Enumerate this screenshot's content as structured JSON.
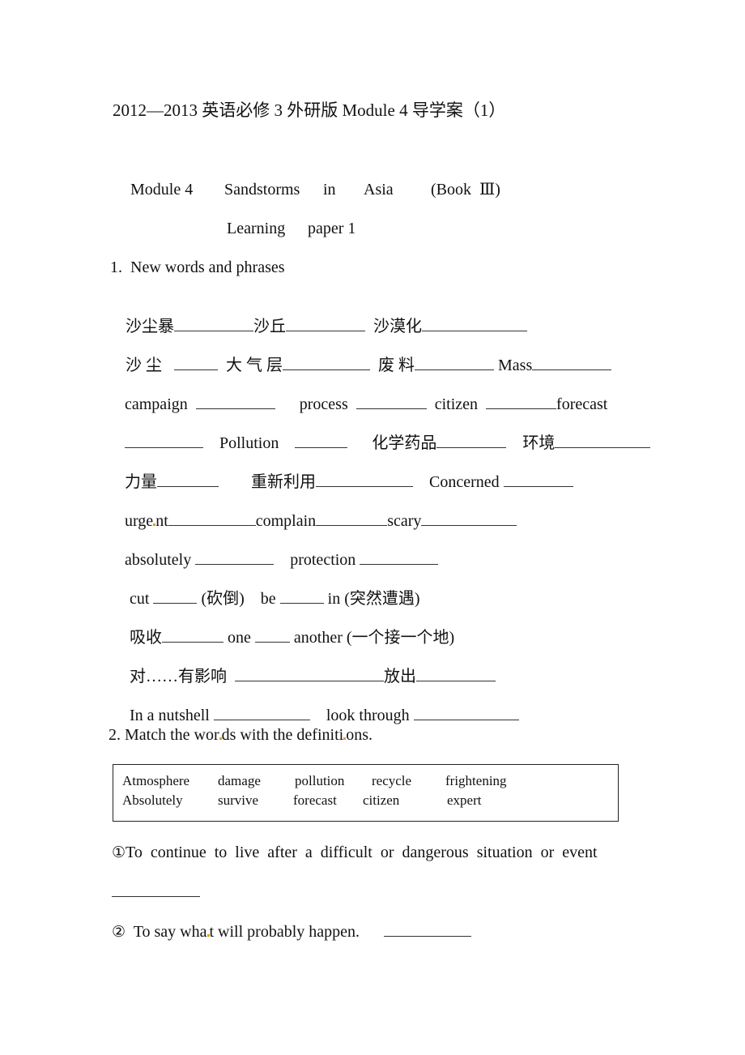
{
  "document": {
    "title": "2012—2013 英语必修 3 外研版 Module 4 导学案（1）",
    "header": {
      "module": "Module 4",
      "w1": "Sandstorms",
      "w2": "in",
      "w3": "Asia",
      "book": "(Book  Ⅲ)",
      "subtitle_a": "Learning",
      "subtitle_b": "paper 1"
    },
    "section1": {
      "heading": "1.  New words and phrases",
      "items": {
        "sandstorm": "沙尘暴",
        "dune": "沙丘",
        "desertification": "沙漠化",
        "dust": "沙 尘",
        "atmosphere": "大 气 层",
        "waste": "废 料",
        "mass": "Mass",
        "campaign": "campaign",
        "process": "process",
        "citizen": "citizen",
        "forecast": "forecast",
        "pollution": "Pollution",
        "chemicals": "化学药品",
        "environment": "环境",
        "force": "力量",
        "recycle": "重新利用",
        "concerned": "Concerned",
        "urgent_a": "urge",
        "urgent_b": "nt",
        "complain": "complain",
        "scary": "scary",
        "absolutely": "absolutely",
        "protection": "protection",
        "cut": "cut",
        "cut_hint": "(砍倒)",
        "be": "be",
        "be_hint": "in (突然遭遇)",
        "absorb": "吸收",
        "one": "one",
        "another": "another (一个接一个地)",
        "effect": "对……有影响",
        "release": "放出",
        "nutshell": "In a nutshell",
        "look_through": "look through"
      }
    },
    "section2": {
      "heading_a": "2. Match the wor",
      "heading_b": "ds with the definiti",
      "heading_c": "ons.",
      "word_bank": [
        [
          "Atmosphere",
          "damage",
          "pollution",
          "recycle",
          "frightening"
        ],
        [
          "Absolutely",
          "survive",
          "forecast",
          "citizen",
          "expert"
        ]
      ],
      "definitions": [
        {
          "num": "①",
          "text": "To  continue  to  live  after  a  difficult  or  dangerous  situation  or  event"
        },
        {
          "num": "②",
          "text_a": "To say wha",
          "text_b": "t will probably happen."
        }
      ]
    }
  }
}
